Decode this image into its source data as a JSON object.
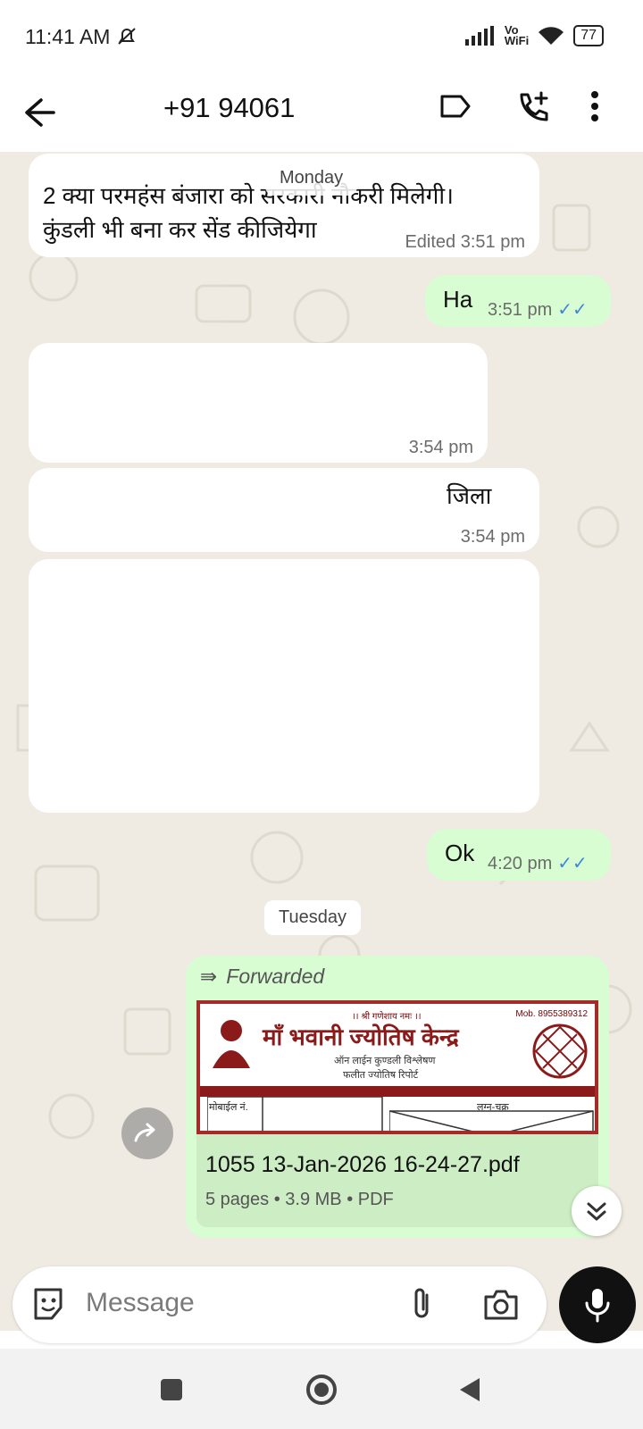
{
  "status": {
    "time": "11:41 AM",
    "vowifi_top": "Vo",
    "vowifi_bottom": "WiFi",
    "battery": "77"
  },
  "header": {
    "contact": "+91 94061"
  },
  "messages": {
    "m1_line1": "2 क्या परमहंस बंजारा को सरकारी नौकरी मिलेगी।",
    "m1_line2": "कुंडली भी बना कर सेंड कीजियेगा",
    "m1_time": "Edited 3:51 pm",
    "date_monday": "Monday",
    "m2_text": "Ha",
    "m2_time": "3:51 pm",
    "m3_time": "3:54 pm",
    "m4_text": "जिला",
    "m4_time": "3:54 pm",
    "m6_text": "Ok",
    "m6_time": "4:20 pm",
    "date_tuesday": "Tuesday",
    "forwarded_label": "Forwarded",
    "doc": {
      "preview_title": "माँ भवानी ज्योतिष केन्द्र",
      "preview_top": "।। श्री गणेशाय नमः ।।",
      "preview_mob": "Mob. 8955389312",
      "preview_sub1": "ऑन लाईन कुण्डली विश्लेषण",
      "preview_sub2": "फलीत ज्योतिष रिपोर्ट",
      "preview_mobile_label": "मोबाईल नं.",
      "preview_chart_label": "लग्न-चक्र",
      "filename": "1055 13-Jan-2026 16-24-27.pdf",
      "details": "5 pages • 3.9 MB • PDF"
    }
  },
  "composer": {
    "placeholder": "Message"
  },
  "colors": {
    "outgoing": "#d9fdd3",
    "incoming": "#ffffff",
    "chat_bg": "#efeae2",
    "ticks": "#3f86d8"
  }
}
